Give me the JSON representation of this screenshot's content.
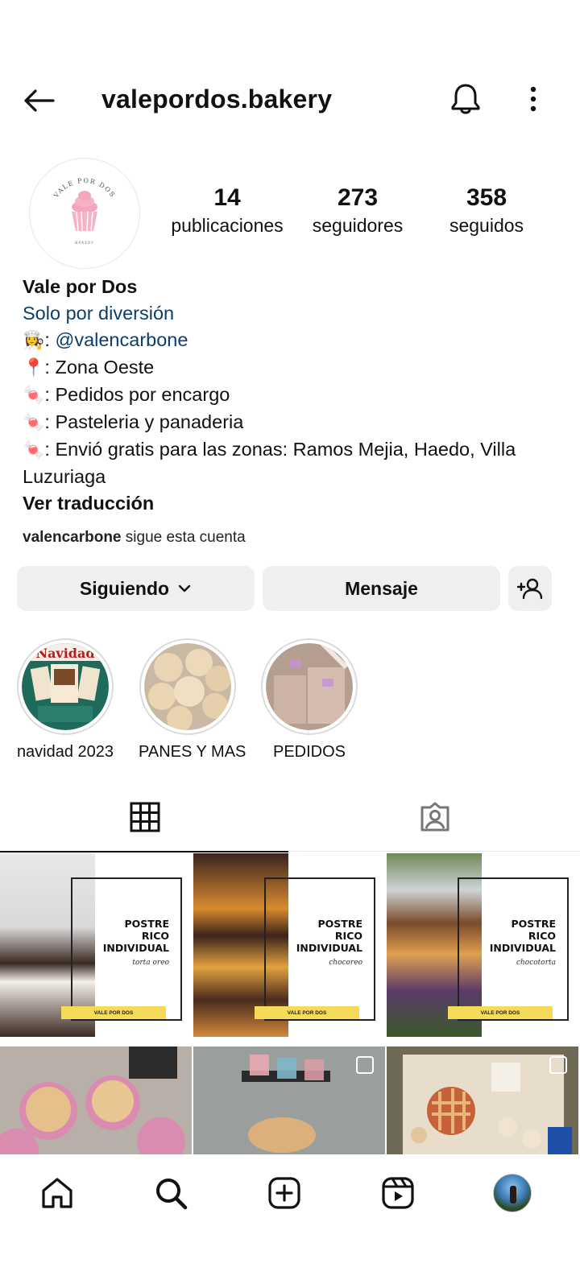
{
  "header": {
    "username": "valepordos.bakery"
  },
  "profile": {
    "avatar_text_top": "VALE POR DOS",
    "avatar_text_bottom": "BAKERY",
    "stats": [
      {
        "value": "14",
        "label": "publicaciones"
      },
      {
        "value": "273",
        "label": "seguidores"
      },
      {
        "value": "358",
        "label": "seguidos"
      }
    ]
  },
  "bio": {
    "name": "Vale por Dos",
    "category": "Solo por diversión",
    "line1_emoji": "👩‍🍳",
    "line1_prefix": ": ",
    "line1_mention": "@valencarbone",
    "line2_emoji": "📍",
    "line2_text": ": Zona Oeste",
    "line3_emoji": "🍬",
    "line3_text": ": Pedidos por encargo",
    "line4_emoji": "🍬",
    "line4_text": ": Pasteleria y panaderia",
    "line5_emoji": "🍬",
    "line5_text": ": Envió gratis para las zonas: Ramos Mejia, Haedo, Villa Luzuriaga",
    "translate": "Ver traducción"
  },
  "followed_by": {
    "user": "valencarbone",
    "text": " sigue esta cuenta"
  },
  "buttons": {
    "following": "Siguiendo",
    "message": "Mensaje"
  },
  "highlights": [
    {
      "label": "navidad 2023"
    },
    {
      "label": "PANES Y MAS"
    },
    {
      "label": "PEDIDOS"
    }
  ],
  "posts": [
    {
      "title_l1": "POSTRE",
      "title_l2": "RICO",
      "title_l3": "INDIVIDUAL",
      "subtitle": "torta oreo",
      "banner": "VALE POR DOS"
    },
    {
      "title_l1": "POSTRE",
      "title_l2": "RICO",
      "title_l3": "INDIVIDUAL",
      "subtitle": "chocoreo",
      "banner": "VALE POR DOS"
    },
    {
      "title_l1": "POSTRE",
      "title_l2": "RICO",
      "title_l3": "INDIVIDUAL",
      "subtitle": "chocotorta",
      "banner": "VALE POR DOS"
    }
  ],
  "colors": {
    "link_blue": "#0b3d6e",
    "button_gray": "#efefef",
    "banner_yellow": "#f6da5a"
  },
  "icons": {
    "back": "arrow-left-icon",
    "bell": "bell-icon",
    "more": "more-vertical-icon",
    "grid": "grid-icon",
    "tagged": "tagged-person-icon",
    "home": "home-icon",
    "search": "search-icon",
    "create": "plus-square-icon",
    "reels": "reels-icon"
  }
}
